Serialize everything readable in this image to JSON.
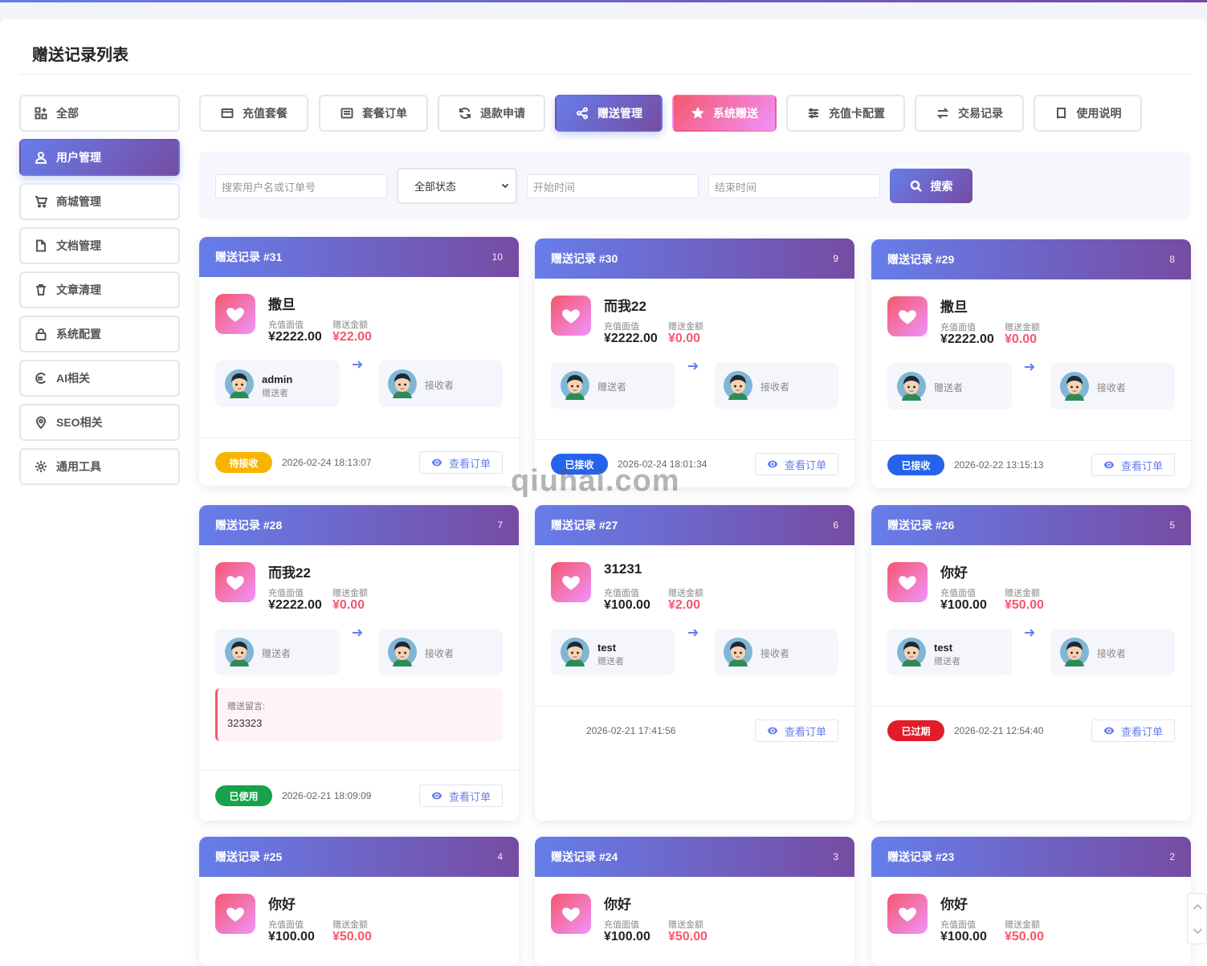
{
  "page": {
    "title": "赠送记录列表",
    "watermark": "qiuhai.com"
  },
  "sidebar": {
    "items": [
      {
        "label": "全部",
        "icon": "grid-plus-icon",
        "active": false
      },
      {
        "label": "用户管理",
        "icon": "user-icon",
        "active": true
      },
      {
        "label": "商城管理",
        "icon": "cart-icon",
        "active": false
      },
      {
        "label": "文档管理",
        "icon": "document-icon",
        "active": false
      },
      {
        "label": "文章清理",
        "icon": "trash-icon",
        "active": false
      },
      {
        "label": "系统配置",
        "icon": "lock-icon",
        "active": false
      },
      {
        "label": "AI相关",
        "icon": "euro-circle-icon",
        "active": false
      },
      {
        "label": "SEO相关",
        "icon": "map-pin-icon",
        "active": false
      },
      {
        "label": "通用工具",
        "icon": "gear-icon",
        "active": false
      }
    ]
  },
  "tabs": [
    {
      "label": "充值套餐",
      "icon": "credit-card-icon",
      "style": "normal"
    },
    {
      "label": "套餐订单",
      "icon": "list-icon",
      "style": "normal"
    },
    {
      "label": "退款申请",
      "icon": "refresh-icon",
      "style": "normal"
    },
    {
      "label": "赠送管理",
      "icon": "share-icon",
      "style": "purple"
    },
    {
      "label": "系统赠送",
      "icon": "star-icon",
      "style": "pink"
    },
    {
      "label": "充值卡配置",
      "icon": "sliders-icon",
      "style": "normal"
    },
    {
      "label": "交易记录",
      "icon": "swap-icon",
      "style": "normal"
    },
    {
      "label": "使用说明",
      "icon": "book-icon",
      "style": "normal"
    }
  ],
  "search": {
    "keyword_placeholder": "搜索用户名或订单号",
    "status_selected": "全部状态",
    "start_placeholder": "开始时间",
    "end_placeholder": "结束时间",
    "button_label": "搜索"
  },
  "labels": {
    "face_value": "充值面值",
    "gift_amount": "赠送金额",
    "sender": "赠送者",
    "receiver": "接收者",
    "message": "赠送留言:",
    "view_order": "查看订单"
  },
  "colors": {
    "primary_start": "#667eea",
    "primary_end": "#764ba2",
    "accent": "#f5576c",
    "status_pending": "#f7b500",
    "status_received": "#2563eb",
    "status_used": "#16a34a",
    "status_expired": "#e11d2a"
  },
  "cards": [
    {
      "title": "赠送记录 #31",
      "num": "10",
      "name": "撒旦",
      "face": "¥2222.00",
      "amount": "¥22.00",
      "sender_name": "admin",
      "status": "待接收",
      "status_kind": "pending",
      "time": "2026-02-24 18:13:07",
      "message": ""
    },
    {
      "title": "赠送记录 #30",
      "num": "9",
      "name": "而我22",
      "face": "¥2222.00",
      "amount": "¥0.00",
      "sender_name": "",
      "status": "已接收",
      "status_kind": "received",
      "time": "2026-02-24 18:01:34",
      "message": ""
    },
    {
      "title": "赠送记录 #29",
      "num": "8",
      "name": "撒旦",
      "face": "¥2222.00",
      "amount": "¥0.00",
      "sender_name": "",
      "status": "已接收",
      "status_kind": "received",
      "time": "2026-02-22 13:15:13",
      "message": ""
    },
    {
      "title": "赠送记录 #28",
      "num": "7",
      "name": "而我22",
      "face": "¥2222.00",
      "amount": "¥0.00",
      "sender_name": "",
      "status": "已使用",
      "status_kind": "used",
      "time": "2026-02-21 18:09:09",
      "message": "323323"
    },
    {
      "title": "赠送记录 #27",
      "num": "6",
      "name": "31231",
      "face": "¥100.00",
      "amount": "¥2.00",
      "sender_name": "test",
      "status": "",
      "status_kind": "none",
      "time": "2026-02-21 17:41:56",
      "message": ""
    },
    {
      "title": "赠送记录 #26",
      "num": "5",
      "name": "你好",
      "face": "¥100.00",
      "amount": "¥50.00",
      "sender_name": "test",
      "status": "已过期",
      "status_kind": "expired",
      "time": "2026-02-21 12:54:40",
      "message": ""
    },
    {
      "title": "赠送记录 #25",
      "num": "4",
      "name": "你好",
      "face": "¥100.00",
      "amount": "¥50.00",
      "sender_name": "",
      "status": "",
      "status_kind": "none",
      "time": "",
      "message": ""
    },
    {
      "title": "赠送记录 #24",
      "num": "3",
      "name": "你好",
      "face": "¥100.00",
      "amount": "¥50.00",
      "sender_name": "",
      "status": "",
      "status_kind": "none",
      "time": "",
      "message": ""
    },
    {
      "title": "赠送记录 #23",
      "num": "2",
      "name": "你好",
      "face": "¥100.00",
      "amount": "¥50.00",
      "sender_name": "",
      "status": "",
      "status_kind": "none",
      "time": "",
      "message": ""
    }
  ]
}
